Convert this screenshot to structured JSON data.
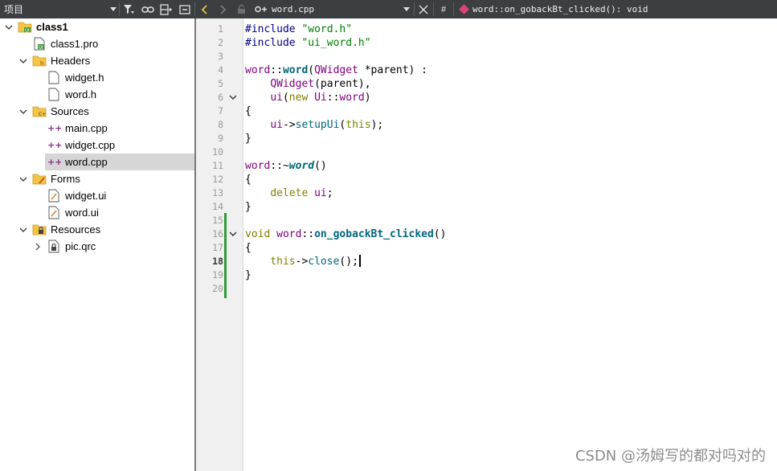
{
  "toolbar": {
    "project_combo": "项目",
    "file_combo": "word.cpp",
    "hash_label": "#",
    "symbol_combo": "word::on_gobackBt_clicked(): void"
  },
  "tree": {
    "project": "class1",
    "pro_file": "class1.pro",
    "headers": "Headers",
    "widget_h": "widget.h",
    "word_h": "word.h",
    "sources": "Sources",
    "main_cpp": "main.cpp",
    "widget_cpp": "widget.cpp",
    "word_cpp": "word.cpp",
    "forms": "Forms",
    "widget_ui": "widget.ui",
    "word_ui": "word.ui",
    "resources": "Resources",
    "pic_qrc": "pic.qrc"
  },
  "editor": {
    "line_numbers": [
      "1",
      "2",
      "3",
      "4",
      "5",
      "6",
      "7",
      "8",
      "9",
      "10",
      "11",
      "12",
      "13",
      "14",
      "15",
      "16",
      "17",
      "18",
      "19",
      "20"
    ],
    "current_line": "18",
    "lines": [
      [
        [
          "pp",
          "#include "
        ],
        [
          "str",
          "\"word.h\""
        ]
      ],
      [
        [
          "pp",
          "#include "
        ],
        [
          "str",
          "\"ui_word.h\""
        ]
      ],
      [],
      [
        [
          "cls",
          "word"
        ],
        [
          "",
          "::"
        ],
        [
          "fnb",
          "word"
        ],
        [
          "",
          "("
        ],
        [
          "cls",
          "QWidget"
        ],
        [
          "",
          " *parent) :"
        ]
      ],
      [
        [
          "",
          "    "
        ],
        [
          "cls",
          "QWidget"
        ],
        [
          "",
          "(parent),"
        ]
      ],
      [
        [
          "",
          "    "
        ],
        [
          "cls",
          "ui"
        ],
        [
          "",
          "("
        ],
        [
          "k",
          "new"
        ],
        [
          "",
          " "
        ],
        [
          "cls",
          "Ui"
        ],
        [
          "",
          "::"
        ],
        [
          "cls",
          "word"
        ],
        [
          "",
          ")"
        ]
      ],
      [
        [
          "",
          "{"
        ]
      ],
      [
        [
          "",
          "    "
        ],
        [
          "cls",
          "ui"
        ],
        [
          "",
          "->"
        ],
        [
          "fn",
          "setupUi"
        ],
        [
          "",
          "("
        ],
        [
          "k",
          "this"
        ],
        [
          "",
          ");"
        ]
      ],
      [
        [
          "",
          "}"
        ]
      ],
      [],
      [
        [
          "cls",
          "word"
        ],
        [
          "",
          "::~"
        ],
        [
          "fni",
          "word"
        ],
        [
          "",
          "()"
        ]
      ],
      [
        [
          "",
          "{"
        ]
      ],
      [
        [
          "",
          "    "
        ],
        [
          "k",
          "delete"
        ],
        [
          "",
          " "
        ],
        [
          "cls",
          "ui"
        ],
        [
          "",
          ";"
        ]
      ],
      [
        [
          "",
          "}"
        ]
      ],
      [],
      [
        [
          "k",
          "void"
        ],
        [
          "",
          " "
        ],
        [
          "cls",
          "word"
        ],
        [
          "",
          "::"
        ],
        [
          "fnb",
          "on_gobackBt_clicked"
        ],
        [
          "",
          "()"
        ]
      ],
      [
        [
          "",
          "{"
        ]
      ],
      [
        [
          "",
          "    "
        ],
        [
          "k",
          "this"
        ],
        [
          "",
          "->"
        ],
        [
          "fn",
          "close"
        ],
        [
          "",
          "();"
        ]
      ],
      [
        [
          "",
          "}"
        ]
      ],
      []
    ]
  },
  "watermark": "CSDN @汤姆写的都对吗对的",
  "colors": {
    "toolbar_bg": "#3c3f41",
    "keyword": "#808000",
    "string": "#008000",
    "preprocessor": "#000080",
    "class": "#800080",
    "function": "#00677c",
    "selection": "#d6d6d6",
    "change_marker": "#2e9d3a"
  },
  "icons": [
    "filter-icon",
    "link-icon",
    "split-icon",
    "collapse-icon",
    "back-icon",
    "forward-icon",
    "lock-icon",
    "cpp-file-icon",
    "close-icon",
    "function-diamond-icon"
  ]
}
